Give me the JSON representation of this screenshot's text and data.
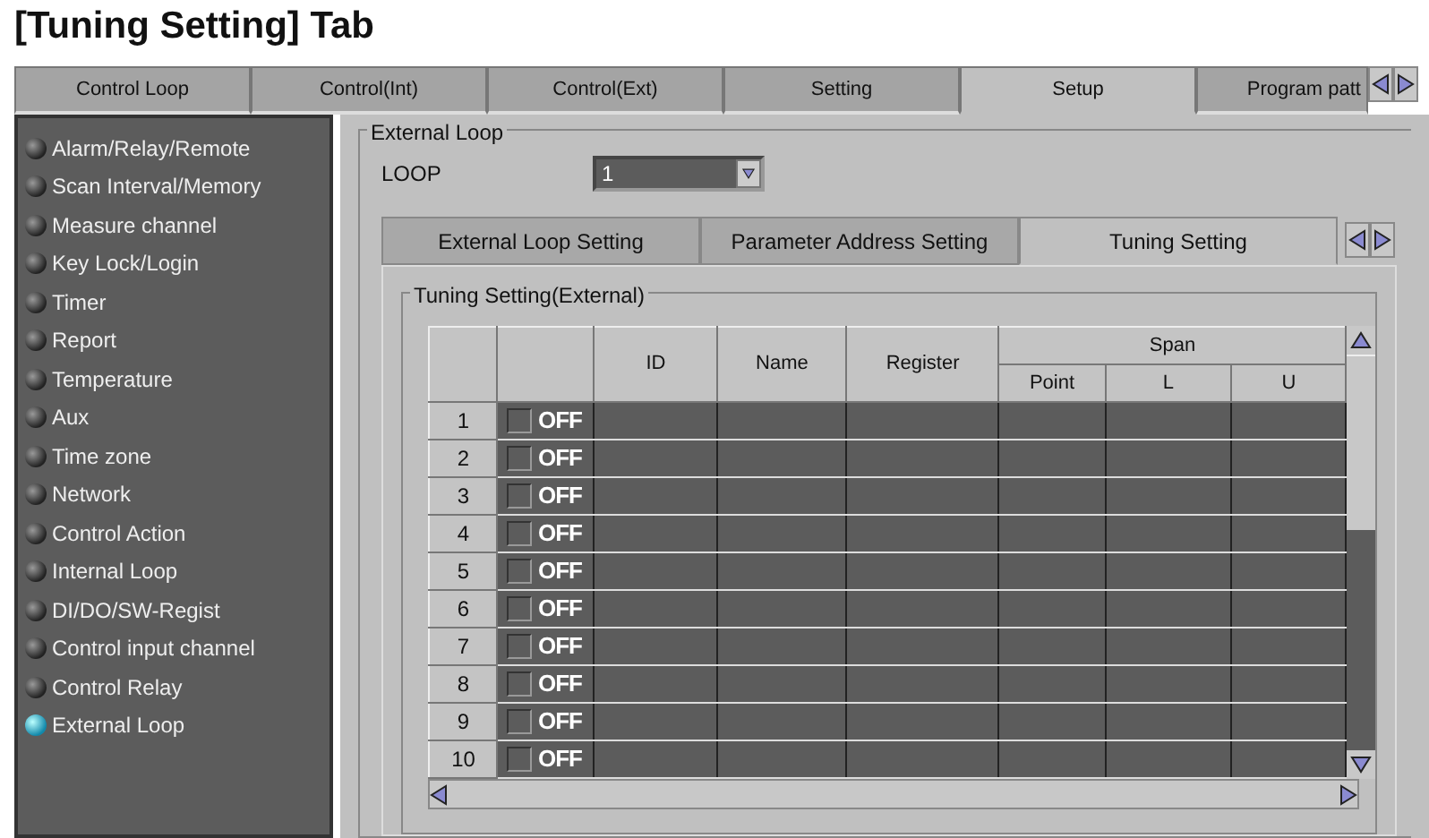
{
  "page_title": "[Tuning Setting] Tab",
  "top_tabs": [
    {
      "label": "Control Loop",
      "selected": false
    },
    {
      "label": "Control(Int)",
      "selected": false
    },
    {
      "label": "Control(Ext)",
      "selected": false
    },
    {
      "label": "Setting",
      "selected": false
    },
    {
      "label": "Setup",
      "selected": true
    },
    {
      "label": "Program patt",
      "selected": false
    }
  ],
  "sidebar": {
    "items": [
      {
        "label": "Alarm/Relay/Remote",
        "selected": false
      },
      {
        "label": "Scan Interval/Memory",
        "selected": false
      },
      {
        "label": "Measure channel",
        "selected": false
      },
      {
        "label": "Key Lock/Login",
        "selected": false
      },
      {
        "label": "Timer",
        "selected": false
      },
      {
        "label": "Report",
        "selected": false
      },
      {
        "label": "Temperature",
        "selected": false
      },
      {
        "label": "Aux",
        "selected": false
      },
      {
        "label": "Time zone",
        "selected": false
      },
      {
        "label": "Network",
        "selected": false
      },
      {
        "label": "Control Action",
        "selected": false
      },
      {
        "label": "Internal Loop",
        "selected": false
      },
      {
        "label": "DI/DO/SW-Regist",
        "selected": false
      },
      {
        "label": "Control input channel",
        "selected": false
      },
      {
        "label": "Control Relay",
        "selected": false
      },
      {
        "label": "External Loop",
        "selected": true
      }
    ]
  },
  "panel": {
    "group_title": "External Loop",
    "loop": {
      "label": "LOOP",
      "value": "1"
    },
    "sub_tabs": [
      {
        "label": "External Loop Setting",
        "selected": false
      },
      {
        "label": "Parameter Address Setting",
        "selected": false
      },
      {
        "label": "Tuning Setting",
        "selected": true
      }
    ],
    "table_group_title": "Tuning Setting(External)",
    "table": {
      "columns": [
        "ID",
        "Name",
        "Register"
      ],
      "span_header": "Span",
      "span_columns": [
        "Point",
        "L",
        "U"
      ],
      "rows": [
        {
          "number": "1",
          "checked": false,
          "toggle": "OFF"
        },
        {
          "number": "2",
          "checked": false,
          "toggle": "OFF"
        },
        {
          "number": "3",
          "checked": false,
          "toggle": "OFF"
        },
        {
          "number": "4",
          "checked": false,
          "toggle": "OFF"
        },
        {
          "number": "5",
          "checked": false,
          "toggle": "OFF"
        },
        {
          "number": "6",
          "checked": false,
          "toggle": "OFF"
        },
        {
          "number": "7",
          "checked": false,
          "toggle": "OFF"
        },
        {
          "number": "8",
          "checked": false,
          "toggle": "OFF"
        },
        {
          "number": "9",
          "checked": false,
          "toggle": "OFF"
        },
        {
          "number": "10",
          "checked": false,
          "toggle": "OFF"
        }
      ]
    }
  }
}
